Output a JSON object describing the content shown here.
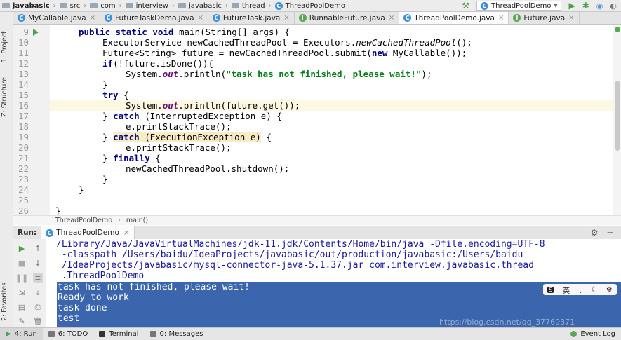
{
  "breadcrumbs": [
    "javabasic",
    "src",
    "com",
    "interview",
    "javabasic",
    "thread",
    "ThreadPoolDemo"
  ],
  "run_config": "ThreadPoolDemo",
  "tabs": [
    {
      "label": "MyCallable.java",
      "icon": "C"
    },
    {
      "label": "FutureTaskDemo.java",
      "icon": "C"
    },
    {
      "label": "FutureTask.java",
      "icon": "C"
    },
    {
      "label": "RunnableFuture.java",
      "icon": "I"
    },
    {
      "label": "ThreadPoolDemo.java",
      "icon": "C"
    },
    {
      "label": "Future.java",
      "icon": "I"
    }
  ],
  "left_strip": [
    "1: Project",
    "Z: Structure",
    "2: Favorites"
  ],
  "line_numbers": [
    "9",
    "10",
    "11",
    "12",
    "13",
    "14",
    "15",
    "16",
    "17",
    "18",
    "19",
    "20",
    "21",
    "22",
    "23",
    "24",
    "25",
    "26"
  ],
  "code": {
    "l9": [
      "public static void",
      " main(String[] args) {"
    ],
    "l10": [
      "ExecutorService newCachedThreadPool = Executors.",
      "newCachedThreadPool",
      "();"
    ],
    "l11": [
      "Future<String> future = newCachedThreadPool.submit(",
      "new",
      " MyCallable());"
    ],
    "l12": [
      "if",
      "(!future.isDone()){"
    ],
    "l13": [
      "System.",
      "out",
      ".println(",
      "\"task has not finished, please wait!\"",
      ");"
    ],
    "l14": [
      "}"
    ],
    "l15": [
      "try",
      " {"
    ],
    "l16": [
      "System.",
      "out",
      ".println(future.get());"
    ],
    "l17": [
      "} ",
      "catch",
      " (InterruptedException e) {"
    ],
    "l18": [
      "e.printStackTrace();"
    ],
    "l19": [
      "} ",
      "catch",
      " (ExecutionException e)",
      " {"
    ],
    "l20": [
      "e.printStackTrace();"
    ],
    "l21": [
      "} ",
      "finally",
      " {"
    ],
    "l22": [
      "newCachedThreadPool.shutdown();"
    ],
    "l23": [
      "}"
    ],
    "l24": [
      "}"
    ],
    "l25": [
      ""
    ],
    "l26": [
      "}"
    ]
  },
  "editor_breadcrumbs": [
    "ThreadPoolDemo",
    "main()"
  ],
  "run_panel": {
    "label": "Run:",
    "tab": "ThreadPoolDemo"
  },
  "console": {
    "command": [
      "/Library/Java/JavaVirtualMachines/jdk-11.jdk/Contents/Home/bin/java -Dfile.encoding=UTF-8",
      " -classpath /Users/baidu/IdeaProjects/javabasic/out/production/javabasic:/Users/baidu",
      " /IdeaProjects/javabasic/mysql-connector-java-5.1.37.jar com.interview.javabasic.thread",
      " .ThreadPoolDemo"
    ],
    "output": [
      "task has not finished, please wait!",
      "Ready to work",
      "task done",
      "test"
    ]
  },
  "ime": [
    "英",
    "¸",
    "☾",
    "⚙"
  ],
  "watermark": "https://blog.csdn.net/qq_37769371",
  "bottom_tabs": [
    "4: Run",
    "6: TODO",
    "Terminal",
    "0: Messages"
  ],
  "event_log": "Event Log",
  "colors": {
    "keyword": "#000080",
    "string": "#067d17",
    "selection": "#3b66ad",
    "current_line": "#fcf8e1"
  }
}
